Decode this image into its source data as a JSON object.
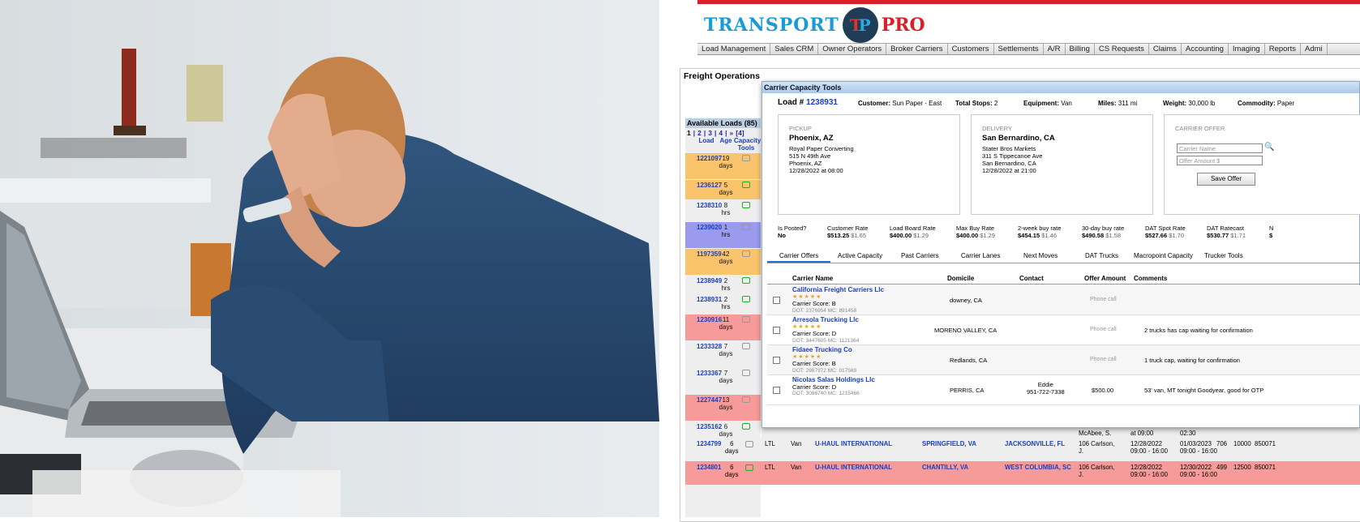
{
  "app": {
    "logo_left": "TRANSPORT",
    "logo_right": "PRO",
    "menu": [
      "Load Management",
      "Sales CRM",
      "Owner Operators",
      "Broker Carriers",
      "Customers",
      "Settlements",
      "A/R",
      "Billing",
      "CS Requests",
      "Claims",
      "Accounting",
      "Imaging",
      "Reports",
      "Admi"
    ],
    "page_title": "Freight Operations"
  },
  "loads": {
    "header": "Available Loads (85)",
    "pager": [
      "1",
      "|",
      "2",
      "|",
      "3",
      "|",
      "4",
      "|",
      "»",
      "[4]"
    ],
    "cols": [
      "Load",
      "Age",
      "Capacity Tools"
    ],
    "rows": [
      {
        "id": "1221097",
        "age": "19",
        "unit": "days",
        "color": "#f9c46b",
        "truck": "grey"
      },
      {
        "id": "1236127",
        "age": "5",
        "unit": "days",
        "color": "#f9c46b",
        "truck": "green"
      },
      {
        "id": "1238310",
        "age": "8",
        "unit": "hrs",
        "color": "#eeeeee",
        "truck": "green"
      },
      {
        "id": "1239020",
        "age": "1",
        "unit": "hrs",
        "color": "#9a9aee",
        "truck": "grey"
      },
      {
        "id": "1197359",
        "age": "42",
        "unit": "days",
        "color": "#f9c46b",
        "truck": "grey"
      },
      {
        "id": "1238949",
        "age": "2",
        "unit": "hrs",
        "color": "#eeeeee",
        "truck": "green"
      },
      {
        "id": "1238931",
        "age": "2",
        "unit": "hrs",
        "color": "#eeeeee",
        "truck": "green"
      },
      {
        "id": "1230916",
        "age": "11",
        "unit": "days",
        "color": "#f79a9a",
        "truck": "grey"
      },
      {
        "id": "1233328",
        "age": "7",
        "unit": "days",
        "color": "#eeeeee",
        "truck": "grey"
      },
      {
        "id": "1233367",
        "age": "7",
        "unit": "days",
        "color": "#eeeeee",
        "truck": "grey"
      },
      {
        "id": "1227447",
        "age": "13",
        "unit": "days",
        "color": "#f79a9a",
        "truck": "grey"
      },
      {
        "id": "1235162",
        "age": "6",
        "unit": "days",
        "color": "#eeeeee",
        "truck": "green"
      },
      {
        "id": "1238925",
        "age": "2",
        "unit": "hrs",
        "color": "#eeeeee",
        "truck": "grey"
      },
      {
        "id": "1234799",
        "age": "6",
        "unit": "days",
        "color": "#eeeeee",
        "truck": "grey"
      },
      {
        "id": "1234801",
        "age": "6",
        "unit": "days",
        "color": "#f79a9a",
        "truck": "green"
      }
    ]
  },
  "bottom_rows": [
    {
      "mode": "LTL",
      "equip": "Van",
      "customer": "U-HAUL INTERNATIONAL",
      "origin": "SPRINGFIELD, VA",
      "dest": "JACKSONVILLE, FL",
      "rep": "106 Carlson, J.",
      "pick": "12/28/2022 09:00 - 16:00",
      "del": "01/03/2023 09:00 - 16:00",
      "miles": "706",
      "weight": "10000",
      "ref": "850071"
    },
    {
      "mode": "LTL",
      "equip": "Van",
      "customer": "U-HAUL INTERNATIONAL",
      "origin": "CHANTILLY, VA",
      "dest": "WEST COLUMBIA, SC",
      "rep": "106 Carlson, J.",
      "pick": "12/28/2022 09:00 - 16:00",
      "del": "12/30/2022 09:00 - 16:00",
      "miles": "499",
      "weight": "12500",
      "ref": "850071"
    }
  ],
  "partial_row": {
    "rep": "McAbee, S.",
    "pick": "at 09:00",
    "del": "02:30"
  },
  "modal": {
    "title": "Carrier Capacity Tools",
    "load_label": "Load #",
    "load_no": "1238931",
    "customer_label": "Customer:",
    "customer": "Sun Paper - East",
    "stops_label": "Total Stops:",
    "stops": "2",
    "equip_label": "Equipment:",
    "equip": "Van",
    "miles_label": "Miles:",
    "miles": "311 mi",
    "weight_label": "Weight:",
    "weight": "30,000 lb",
    "commodity_label": "Commodity:",
    "commodity": "Paper",
    "pickup": {
      "cap": "PICKUP",
      "city": "Phoenix, AZ",
      "l1": "Royal Paper Converting",
      "l2": "515 N 49th Ave",
      "l3": "Phoenix, AZ",
      "l4": "12/28/2022 at 08:00"
    },
    "delivery": {
      "cap": "DELIVERY",
      "city": "San Bernardino, CA",
      "l1": "Stater Bros Markets",
      "l2": "311 S Tippecanoe Ave",
      "l3": "San Bernardino, CA",
      "l4": "12/28/2022 at 21:00"
    },
    "offer": {
      "cap": "CARRIER OFFER",
      "name_ph": "Carrier Name",
      "amount_ph": "Offer Amount $",
      "save": "Save Offer"
    },
    "rates": [
      {
        "label": "Is Posted?",
        "val": "No",
        "sub": ""
      },
      {
        "label": "Customer Rate",
        "val": "$513.25",
        "sub": "$1.65"
      },
      {
        "label": "Load Board Rate",
        "val": "$400.00",
        "sub": "$1.29"
      },
      {
        "label": "Max Buy Rate",
        "val": "$400.00",
        "sub": "$1.29"
      },
      {
        "label": "2-week buy rate",
        "val": "$454.15",
        "sub": "$1.46"
      },
      {
        "label": "30-day buy rate",
        "val": "$490.58",
        "sub": "$1.58"
      },
      {
        "label": "DAT Spot Rate",
        "val": "$527.66",
        "sub": "$1.70"
      },
      {
        "label": "DAT Ratecast",
        "val": "$530.77",
        "sub": "$1.71"
      },
      {
        "label": "N",
        "val": "$",
        "sub": ""
      }
    ],
    "tabs": [
      "Carrier Offers",
      "Active Capacity",
      "Past Carriers",
      "Carrier Lanes",
      "Next Moves",
      "DAT Trucks",
      "Macropoint Capacity",
      "Trucker Tools"
    ],
    "cols": [
      "Carrier Name",
      "Domicile",
      "Contact",
      "Offer Amount",
      "Comments"
    ],
    "carriers": [
      {
        "name": "California Freight Carriers Llc",
        "stars": "★★★★★",
        "score": "Carrier Score: B",
        "dot": "DOT: 2376954   MC: 891458",
        "domicile": "downey, CA",
        "contact": "",
        "contact2": "",
        "amount": "Phone call",
        "comment": ""
      },
      {
        "name": "Arresola Trucking Llc",
        "stars": "★★★★★",
        "score": "Carrier Score: D",
        "dot": "DOT: 3447605   MC: 1121364",
        "domicile": "MORENO VALLEY, CA",
        "contact": "",
        "contact2": "",
        "amount": "Phone call",
        "comment": "2 trucks has cap waiting for confirmation"
      },
      {
        "name": "Fidaee Trucking Co",
        "stars": "★★★★★",
        "score": "Carrier Score: B",
        "dot": "DOT: 2987972   MC: 017569",
        "domicile": "Redlands, CA",
        "contact": "",
        "contact2": "",
        "amount": "Phone call",
        "comment": "1 truck cap, waiting for confirmation"
      },
      {
        "name": "Nicolas Salas Holdings Llc",
        "stars": "",
        "score": "Carrier Score: D",
        "dot": "DOT: 3086740   MC: 1215466",
        "domicile": "PERRIS, CA",
        "contact": "Eddie",
        "contact2": "951-722-7338",
        "amount": "$500.00",
        "comment": "53' van, MT tonight Goodyear, good for OTP"
      }
    ]
  },
  "colors": {
    "brand_blue": "#1c9ad6",
    "brand_red": "#d8202a",
    "link": "#1a3fbf",
    "star": "#f0a020"
  }
}
